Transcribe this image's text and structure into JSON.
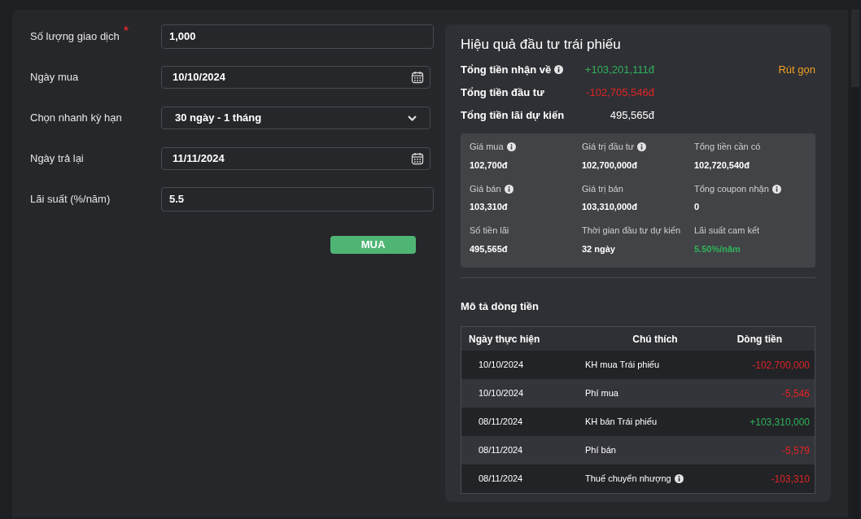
{
  "form": {
    "fields": [
      {
        "label": "Số lượng giao dịch",
        "required_mark": "*",
        "kind": "text",
        "value": "1,000"
      },
      {
        "label": "Ngày mua",
        "kind": "date",
        "value": "10/10/2024"
      },
      {
        "label": "Chọn nhanh kỳ hạn",
        "kind": "select",
        "value": "30 ngày - 1 tháng"
      },
      {
        "label": "Ngày trả lại",
        "kind": "date",
        "value": "11/11/2024"
      },
      {
        "label": "Lãi suất (%/năm)",
        "kind": "text",
        "value": "5.5"
      }
    ],
    "submit": "MUA"
  },
  "summary": {
    "title": "Hiệu quả đầu tư trái phiếu",
    "collapse_link": "Rút gọn",
    "totals": [
      {
        "label": "Tổng tiền nhận về",
        "info": true,
        "value": "+103,201,111đ",
        "color": "#2fb35a"
      },
      {
        "label": "Tổng tiền đầu tư",
        "info": false,
        "value": "-102,705,546đ",
        "color": "#e02424"
      },
      {
        "label": "Tổng tiền lãi dự kiến",
        "info": false,
        "value": "495,565đ",
        "color": "#ffffff"
      }
    ],
    "stats": [
      {
        "label": "Giá mua",
        "info": true,
        "value": "102,700đ",
        "color": "#ffffff"
      },
      {
        "label": "Giá trị đầu tư",
        "info": true,
        "value": "102,700,000đ",
        "color": "#ffffff"
      },
      {
        "label": "Tổng tiền cần có",
        "info": false,
        "value": "102,720,540đ",
        "color": "#ffffff"
      },
      {
        "label": "Giá bán",
        "info": true,
        "value": "103,310đ",
        "color": "#ffffff"
      },
      {
        "label": "Giá trị bán",
        "info": false,
        "value": "103,310,000đ",
        "color": "#ffffff"
      },
      {
        "label": "Tổng coupon nhận",
        "info": true,
        "value": "0",
        "color": "#ffffff"
      },
      {
        "label": "Số tiền lãi",
        "info": false,
        "value": "495,565đ",
        "color": "#ffffff"
      },
      {
        "label": "Thời gian đầu tư dự kiến",
        "info": false,
        "value": "32 ngày",
        "color": "#ffffff"
      },
      {
        "label": "Lãi suất cam kết",
        "info": false,
        "value": "5.50%/năm",
        "color": "#2fb35a"
      }
    ]
  },
  "cashflow": {
    "title": "Mô tả dòng tiền",
    "columns": [
      "Ngày thực hiện",
      "Chú thích",
      "Dòng tiền"
    ],
    "rows": [
      {
        "date": "10/10/2024",
        "note": "KH mua Trái phiếu",
        "info": false,
        "amount": "-102,700,000",
        "color": "#e02424"
      },
      {
        "date": "10/10/2024",
        "note": "Phí mua",
        "info": false,
        "amount": "-5,546",
        "color": "#e02424"
      },
      {
        "date": "08/11/2024",
        "note": "KH bán Trái phiếu",
        "info": false,
        "amount": "+103,310,000",
        "color": "#2fb35a"
      },
      {
        "date": "08/11/2024",
        "note": "Phí bán",
        "info": false,
        "amount": "-5,579",
        "color": "#e02424"
      },
      {
        "date": "08/11/2024",
        "note": "Thuế chuyển nhượng",
        "info": true,
        "amount": "-103,310",
        "color": "#e02424"
      }
    ]
  }
}
